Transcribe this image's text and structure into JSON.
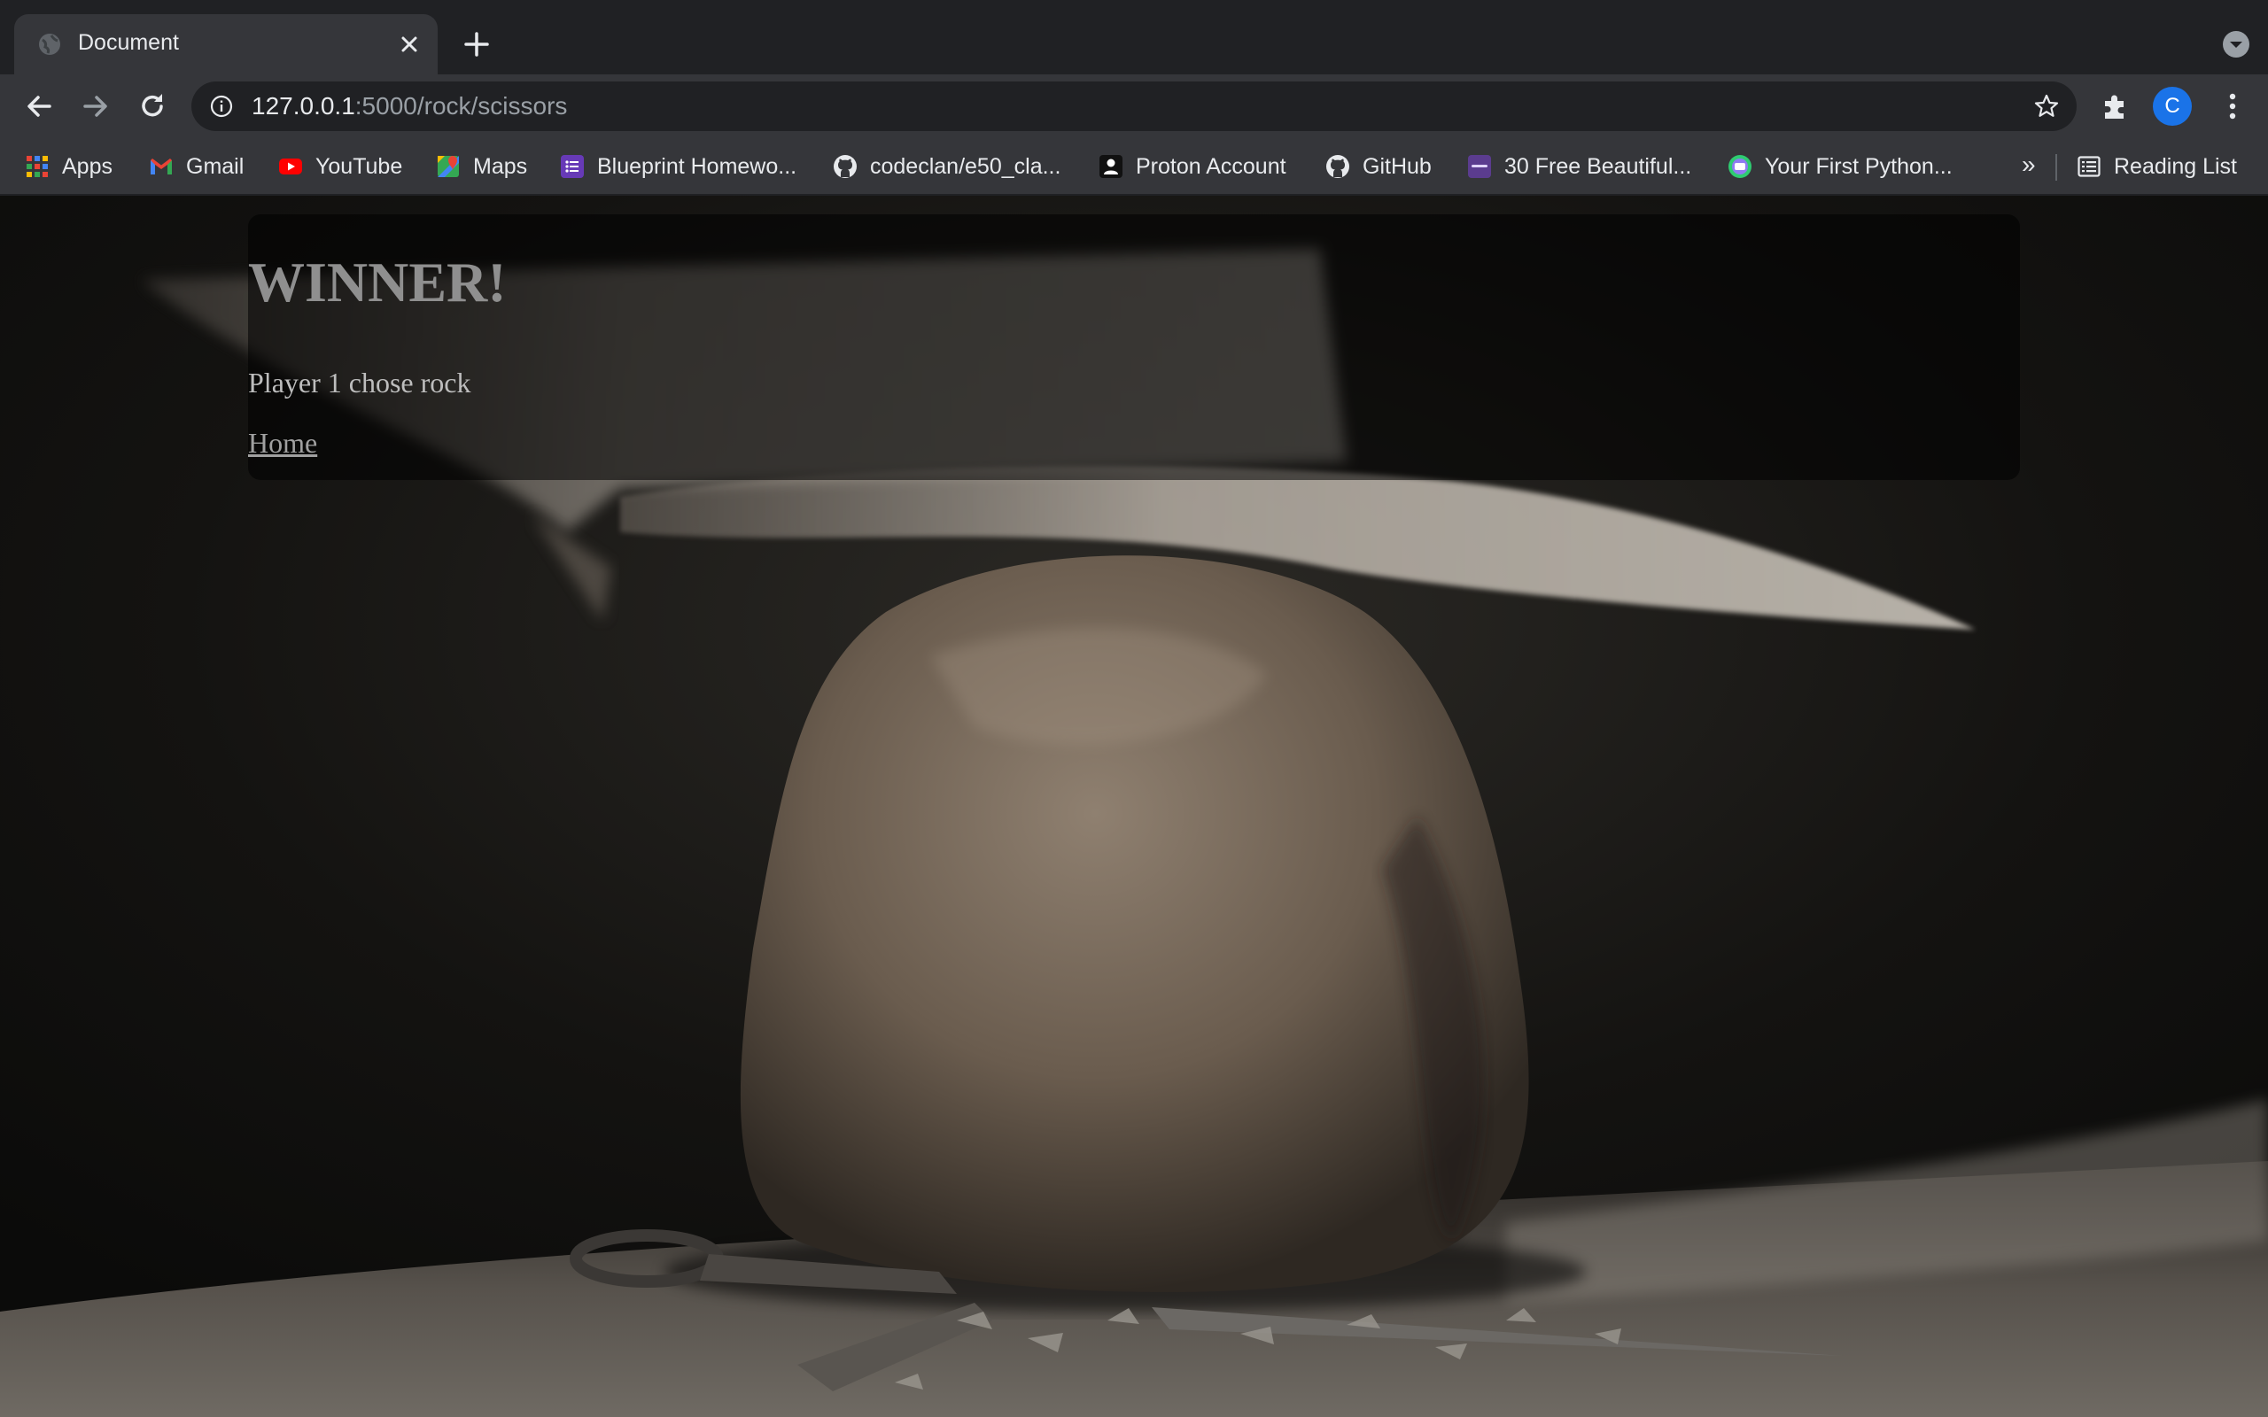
{
  "browser": {
    "tab": {
      "title": "Document"
    },
    "address": {
      "host": "127.0.0.1",
      "rest": ":5000/rock/scissors"
    },
    "profile_initial": "C",
    "bookmarks": [
      {
        "label": "Apps",
        "icon": "apps-grid-icon"
      },
      {
        "label": "Gmail",
        "icon": "gmail-icon"
      },
      {
        "label": "YouTube",
        "icon": "youtube-icon"
      },
      {
        "label": "Maps",
        "icon": "maps-icon"
      },
      {
        "label": "Blueprint Homewo...",
        "icon": "list-icon"
      },
      {
        "label": "codeclan/e50_cla...",
        "icon": "github-icon"
      },
      {
        "label": "Proton Account",
        "icon": "proton-icon"
      },
      {
        "label": "GitHub",
        "icon": "github-icon"
      },
      {
        "label": "30 Free Beautiful...",
        "icon": "colorlib-icon"
      },
      {
        "label": "Your First Python...",
        "icon": "python-course-icon"
      }
    ],
    "more_bookmarks": "»",
    "reading_list": "Reading List"
  },
  "page": {
    "heading": "WINNER!",
    "result": "Player 1 chose rock",
    "home_link": "Home"
  },
  "colors": {
    "chrome_dark": "#202124",
    "chrome_toolbar": "#35363a",
    "avatar_blue": "#1a73e8"
  }
}
